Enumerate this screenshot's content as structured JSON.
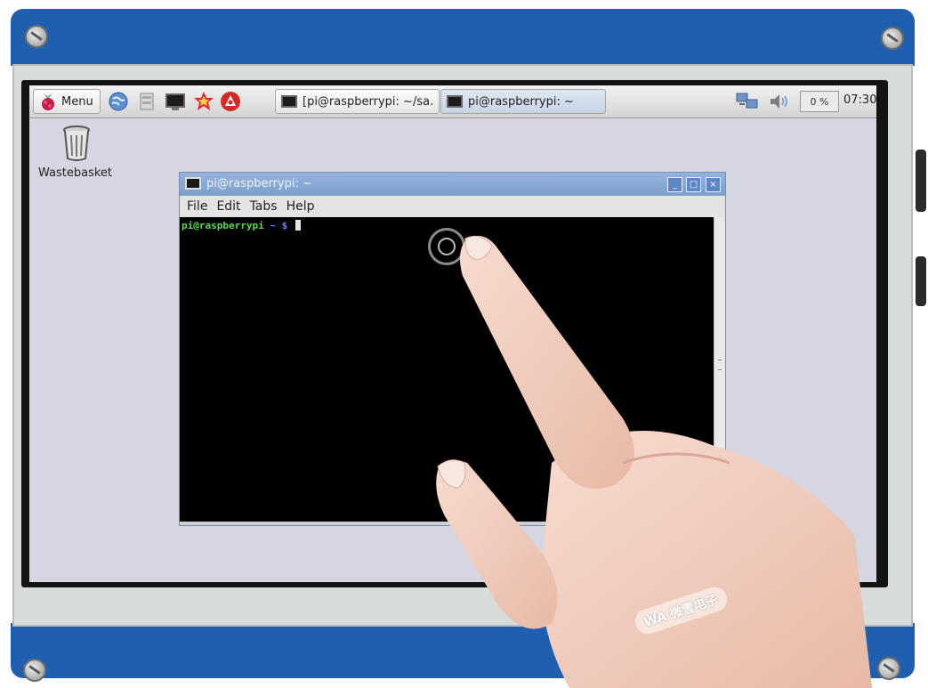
{
  "taskbar": {
    "menu_label": "Menu",
    "launchers": [
      "web-browser-icon",
      "file-manager-icon",
      "terminal-icon",
      "mathematica-icon",
      "wolfram-icon"
    ],
    "tasks": [
      {
        "label": "[pi@raspberrypi: ~/sa..."
      },
      {
        "label": "pi@raspberrypi: ~"
      }
    ],
    "tray": {
      "network_icon": "network-icon",
      "volume_icon": "volume-icon",
      "cpu_value": "0 %",
      "clock": "07:30"
    }
  },
  "desktop": {
    "icons": [
      {
        "label": "Wastebasket"
      }
    ]
  },
  "terminal": {
    "title": "pi@raspberrypi: ~",
    "menu": [
      "File",
      "Edit",
      "Tabs",
      "Help"
    ],
    "prompt_user": "pi@raspberrypi",
    "prompt_path": " ~ $ ",
    "controls": [
      "_",
      "□",
      "×"
    ]
  },
  "watermark": "WA 微雪电子",
  "colors": {
    "board_blue": "#1f5fb0",
    "titlebar_blue": "#7c9fcb",
    "desktop_bg": "#d6d6e2",
    "prompt_green": "#5bd84f"
  }
}
